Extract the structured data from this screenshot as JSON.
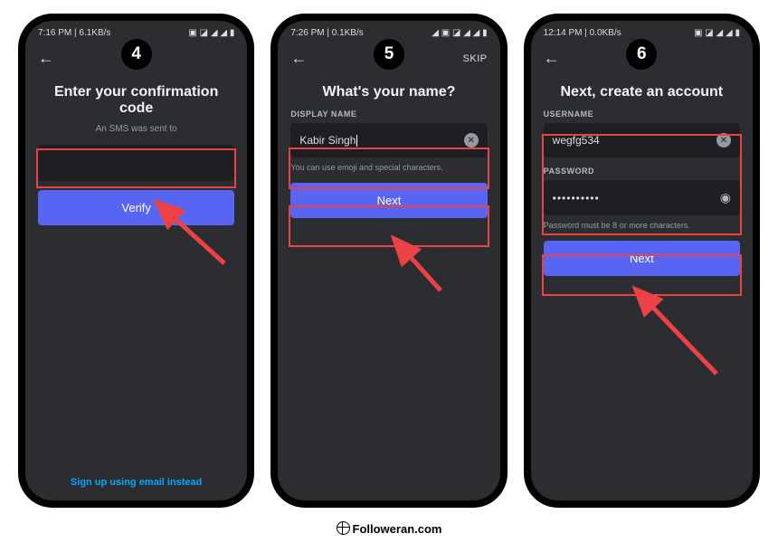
{
  "footer": "Followeran.com",
  "phones": [
    {
      "badge": "4",
      "status_left": "7:16 PM | 6.1KB/s",
      "title": "Enter your confirmation code",
      "subtitle": "An SMS was sent to",
      "button": "Verify",
      "bottom_link": "Sign up using email instead"
    },
    {
      "badge": "5",
      "status_left": "7:26 PM | 0.1KB/s",
      "skip": "SKIP",
      "title": "What's your name?",
      "label1": "DISPLAY NAME",
      "input1": "Kabir Singh",
      "hint1": "You can use emoji and special characters.",
      "button": "Next"
    },
    {
      "badge": "6",
      "status_left": "12:14 PM | 0.0KB/s",
      "title": "Next, create an account",
      "label1": "USERNAME",
      "input1": "wegfg534",
      "label2": "PASSWORD",
      "input2": "••••••••••",
      "hint2": "Password must be 8 or more characters.",
      "button": "Next"
    }
  ]
}
